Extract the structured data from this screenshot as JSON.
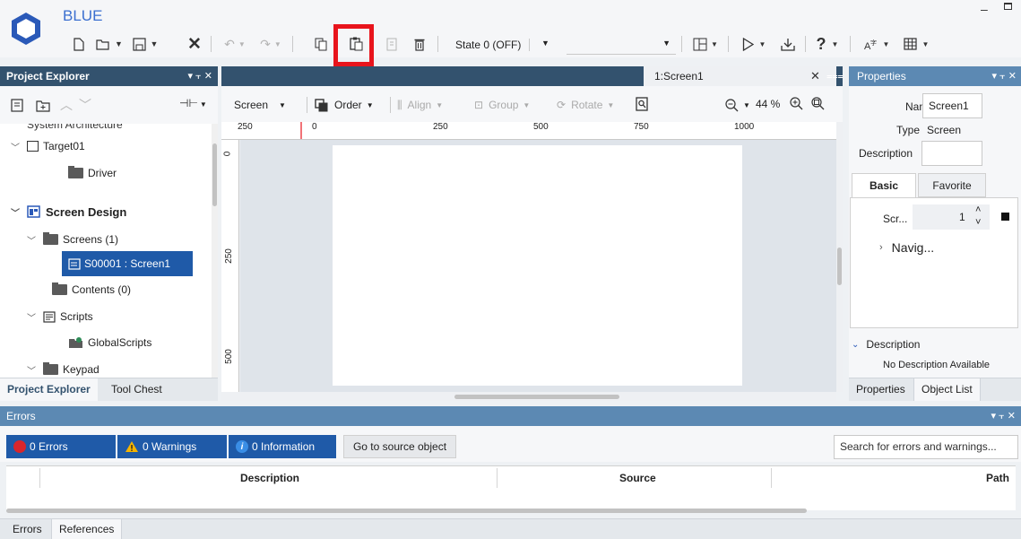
{
  "app": {
    "title": "BLUE"
  },
  "toolbar": {
    "state_label": "State 0 (OFF)",
    "highlighted_tool": "paste-icon"
  },
  "project_explorer": {
    "title": "Project Explorer",
    "header_controls": "▾ ⫟ ✕",
    "tree": {
      "system_architecture": "System Architecture",
      "target": "Target01",
      "driver": "Driver",
      "screen_design": "Screen Design",
      "screens": "Screens (1)",
      "screen_item": "S00001 : Screen1",
      "contents": "Contents (0)",
      "scripts": "Scripts",
      "global_scripts": "GlobalScripts",
      "keypad": "Keypad"
    },
    "tabs": [
      "Project Explorer",
      "Tool Chest"
    ]
  },
  "editor": {
    "tab_label": "1:Screen1",
    "toolbar": {
      "screen": "Screen",
      "order": "Order",
      "align": "Align",
      "group": "Group",
      "rotate": "Rotate",
      "zoom": "44 %"
    },
    "ruler_top": [
      "250",
      "0",
      "250",
      "500",
      "750",
      "1000"
    ],
    "ruler_left": [
      "0",
      "250",
      "500"
    ]
  },
  "properties": {
    "title": "Properties",
    "name_label": "Name",
    "name_value": "Screen1",
    "type_label": "Type",
    "type_value": "Screen",
    "description_label": "Description",
    "tabs": {
      "basic": "Basic",
      "favorite": "Favorite"
    },
    "scr_label": "Scr...",
    "scr_value": "1",
    "navig_label": "Navig...",
    "description_section": "Description",
    "no_description": "No Description Available",
    "bottom_tabs": [
      "Properties",
      "Object List"
    ]
  },
  "errors": {
    "title": "Errors",
    "errors_btn": "0 Errors",
    "warnings_btn": "0 Warnings",
    "info_btn": "0 Information",
    "goto_btn": "Go to source object",
    "search_placeholder": "Search for errors and warnings...",
    "columns": {
      "description": "Description",
      "source": "Source",
      "path": "Path"
    },
    "bottom_tabs": [
      "Errors",
      "References"
    ]
  },
  "colors": {
    "accent": "#33526e",
    "panel_blue": "#5c89b3",
    "selection": "#1f5aa8",
    "highlight_box": "#e8141c"
  }
}
